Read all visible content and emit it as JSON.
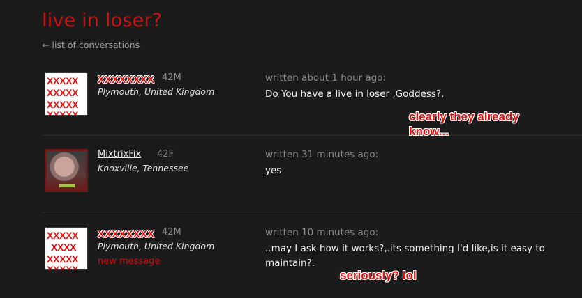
{
  "page": {
    "title": "live in loser?",
    "back_arrow": "←",
    "back_link": "list of conversations"
  },
  "messages": [
    {
      "username": "XXXXXXXX",
      "age_sex": "42M",
      "location": "Plymouth, United Kingdom",
      "avatar_text": [
        "XXXXX",
        "XXXXX",
        "XXXXX",
        "XXXXX"
      ],
      "written": "written about 1 hour ago:",
      "text": "Do You have a live in loser ,Goddess?,",
      "new_message": ""
    },
    {
      "username": "MixtrixFix",
      "age_sex": "42F",
      "location": "Knoxville, Tennessee",
      "written": "written 31 minutes ago:",
      "text": "yes",
      "new_message": ""
    },
    {
      "username": "XXXXXXXX",
      "age_sex": "42M",
      "location": "Plymouth, United Kingdom",
      "avatar_text": [
        "XXXXX",
        "XXXX",
        "XXXXX",
        "XXXXX"
      ],
      "written": "written 10 minutes ago:",
      "text": "..may I ask how it works?,.its something I'd like,is it easy to maintain?.",
      "new_message": "new message"
    }
  ],
  "annotations": {
    "first": "clearly they already know...",
    "second": "seriously? lol"
  },
  "colors": {
    "background": "#1b1b1b",
    "title_red": "#cc1111",
    "annotation_red": "#e01010"
  }
}
